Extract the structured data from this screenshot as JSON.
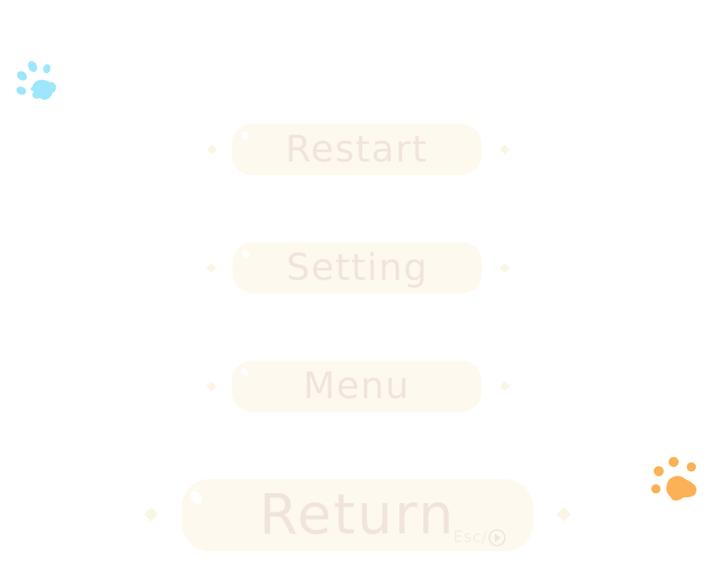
{
  "menu": {
    "restart_label": "Restart",
    "setting_label": "Setting",
    "menu_label": "Menu",
    "return_label": "Return",
    "return_hint": "Esc/"
  },
  "icons": {
    "top_left": "paw-print-icon",
    "bottom_right": "paw-print-icon",
    "return_hint_icon": "circle-play-icon"
  },
  "colors": {
    "button_bg": "#fdf9ee",
    "button_text": "#f1e4de",
    "paw_blue": "#9ee6fb",
    "paw_orange": "#fbb155",
    "diamond": "#fbf5e4"
  }
}
